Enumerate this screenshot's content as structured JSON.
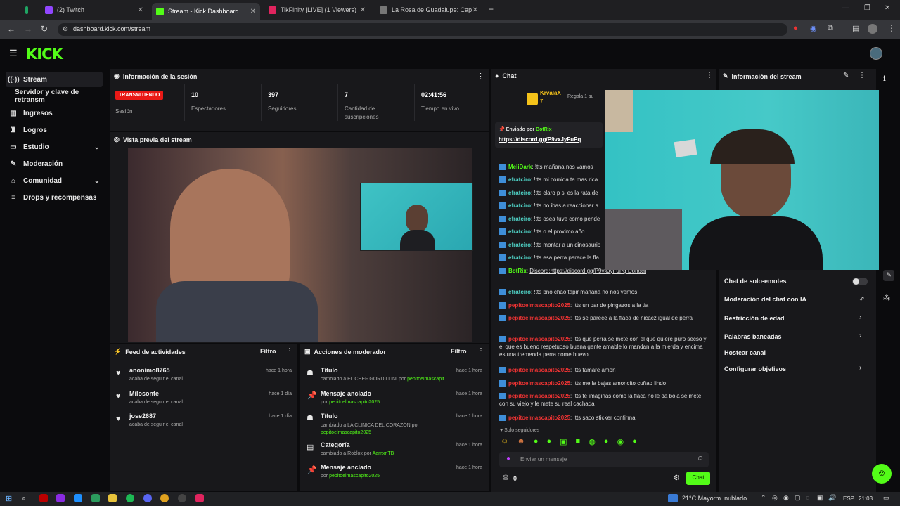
{
  "browser": {
    "tabs": [
      {
        "label": "(2) Twitch",
        "color": "#9146ff"
      },
      {
        "label": "Stream - Kick Dashboard",
        "color": "#53fc18"
      },
      {
        "label": "TikFinity [LIVE] (1 Viewers)",
        "color": "#e0245e"
      },
      {
        "label": "La Rosa de Guadalupe: Cap",
        "color": "#777777"
      }
    ],
    "url": "dashboard.kick.com/stream"
  },
  "app": {
    "logo": "KICK"
  },
  "sidebar": {
    "items": [
      {
        "label": "Stream",
        "icon": "broadcast-icon"
      },
      {
        "label": "Servidor y clave de retransm",
        "icon": ""
      },
      {
        "label": "Ingresos",
        "icon": "chart-icon"
      },
      {
        "label": "Logros",
        "icon": "trophy-icon"
      },
      {
        "label": "Estudio",
        "icon": "studio-icon"
      },
      {
        "label": "Moderación",
        "icon": "wrench-icon"
      },
      {
        "label": "Comunidad",
        "icon": "community-icon"
      },
      {
        "label": "Drops y recompensas",
        "icon": "drops-icon"
      }
    ]
  },
  "session": {
    "title": "Información de la sesión",
    "status": "TRANSMITIENDO",
    "status_label": "Sesión",
    "stats": [
      {
        "value": "10",
        "label": "Espectadores"
      },
      {
        "value": "397",
        "label": "Seguidores"
      },
      {
        "value": "7",
        "label": "Cantidad de suscripciones"
      },
      {
        "value": "02:41:56",
        "label": "Tiempo en vivo"
      }
    ]
  },
  "preview": {
    "title": "Vista previa del stream"
  },
  "feed": {
    "title": "Feed de actividades",
    "filter": "Filtro",
    "items": [
      {
        "name": "anonimo8765",
        "sub": "acaba de seguir el canal",
        "time": "hace 1 hora"
      },
      {
        "name": "Milosonte",
        "sub": "acaba de seguir el canal",
        "time": "hace 1 día"
      },
      {
        "name": "jose2687",
        "sub": "acaba de seguir el canal",
        "time": "hace 1 día"
      }
    ]
  },
  "modactions": {
    "title": "Acciones de moderador",
    "filter": "Filtro",
    "items": [
      {
        "name": "Título",
        "sub": "cambiado a EL CHEF GORDILLINI por",
        "user": "pepitoelmascapito2025",
        "time": "hace 1 hora"
      },
      {
        "name": "Mensaje anclado",
        "sub": "por",
        "user": "pepitoelmascapito2025",
        "time": "hace 1 hora"
      },
      {
        "name": "Título",
        "sub": "cambiado a LA CLINICA DEL CORAZÓN por",
        "user": "pepitoelmascapito2025",
        "time": "hace 1 hora"
      },
      {
        "name": "Categoría",
        "sub": "cambiado a Roblox por",
        "user": "AamxnTB",
        "time": "hace 1 hora"
      },
      {
        "name": "Mensaje anclado",
        "sub": "por",
        "user": "pepitoelmascapito2025",
        "time": "hace 1 hora"
      }
    ]
  },
  "chat": {
    "title": "Chat",
    "top_user": "KrvalaX",
    "top_count": "7",
    "gift_text": "Regala 1 su",
    "pinned_by": "Enviado por",
    "pinned_user": "BotRix",
    "pinned_link": "https://discord.gg/P9vxJyFuPq",
    "lines": [
      {
        "user": "MeliDark",
        "color": "green",
        "text": "!tts mañana nos vamos"
      },
      {
        "user": "efratciro",
        "color": "cyan",
        "text": "!tts mi comida ta mas rica"
      },
      {
        "user": "efratciro",
        "color": "cyan",
        "text": "!tts claro p si es la rata de"
      },
      {
        "user": "efratciro",
        "color": "cyan",
        "text": "!tts no ibas a reaccionar a"
      },
      {
        "user": "efratciro",
        "color": "cyan",
        "text": "!tts osea tuve como pende"
      },
      {
        "user": "efratciro",
        "color": "cyan",
        "text": "!tts o el proximo año"
      },
      {
        "user": "efratciro",
        "color": "cyan",
        "text": "!tts montar a un dinosaurio"
      },
      {
        "user": "efratciro",
        "color": "cyan",
        "text": "!tts esa perra parece la fla"
      }
    ],
    "botrix_line": "Discord:https://discord.gg/P9vxJyFuPq Donoclip:https://www.donoclip.com/Aamxn",
    "lines2": [
      {
        "user": "efratciro",
        "color": "cyan",
        "text": "!tts bno chao tapir mañana no nos vemos"
      },
      {
        "user": "pepitoelmascapito2025",
        "color": "red",
        "text": "!tts un par de pingazos a la tia"
      },
      {
        "user": "pepitoelmascapito2025",
        "color": "red",
        "text": "!tts se parece a la flaca de nicacz igual de perra"
      },
      {
        "user": "pepitoelmascapito2025",
        "color": "red",
        "text": "!tts que perra se mete con el que quiere puro secso y el que es bueno respetuoso buena gente amable lo mandan a la mierda y encima es una tremenda perra come huevo"
      },
      {
        "user": "pepitoelmascapito2025",
        "color": "red",
        "text": "!tts tamare amon"
      },
      {
        "user": "pepitoelmascapito2025",
        "color": "red",
        "text": "!tts me la bajas amoncito cuñao lindo"
      },
      {
        "user": "pepitoelmascapito2025",
        "color": "red",
        "text": "!tts te imaginas como la flaca no le da bola se mete con su viejo y le mete su real cachada"
      },
      {
        "user": "pepitoelmascapito2025",
        "color": "red",
        "text": "!tts saco sticker confirma"
      }
    ],
    "followers_only": "Solo seguidores",
    "input_placeholder": "Enviar un mensaje",
    "points": "0",
    "send_label": "Chat"
  },
  "streaminfo": {
    "title": "Información del stream",
    "settings": [
      {
        "label": "Chat de solo-emotes",
        "control": "toggle"
      },
      {
        "label": "Moderación del chat con IA",
        "control": "external"
      },
      {
        "label": "Restricción de edad",
        "control": "chevron"
      },
      {
        "label": "Palabras baneadas",
        "control": "chevron"
      },
      {
        "label": "Hostear canal",
        "control": "none"
      },
      {
        "label": "Configurar objetivos",
        "control": "chevron"
      }
    ]
  },
  "taskbar": {
    "weather": "21°C  Mayorm. nublado",
    "lang": "ESP",
    "time": "21:03"
  },
  "colors": {
    "accent": "#53fc18",
    "live": "#e91916",
    "panel": "#18181b"
  }
}
